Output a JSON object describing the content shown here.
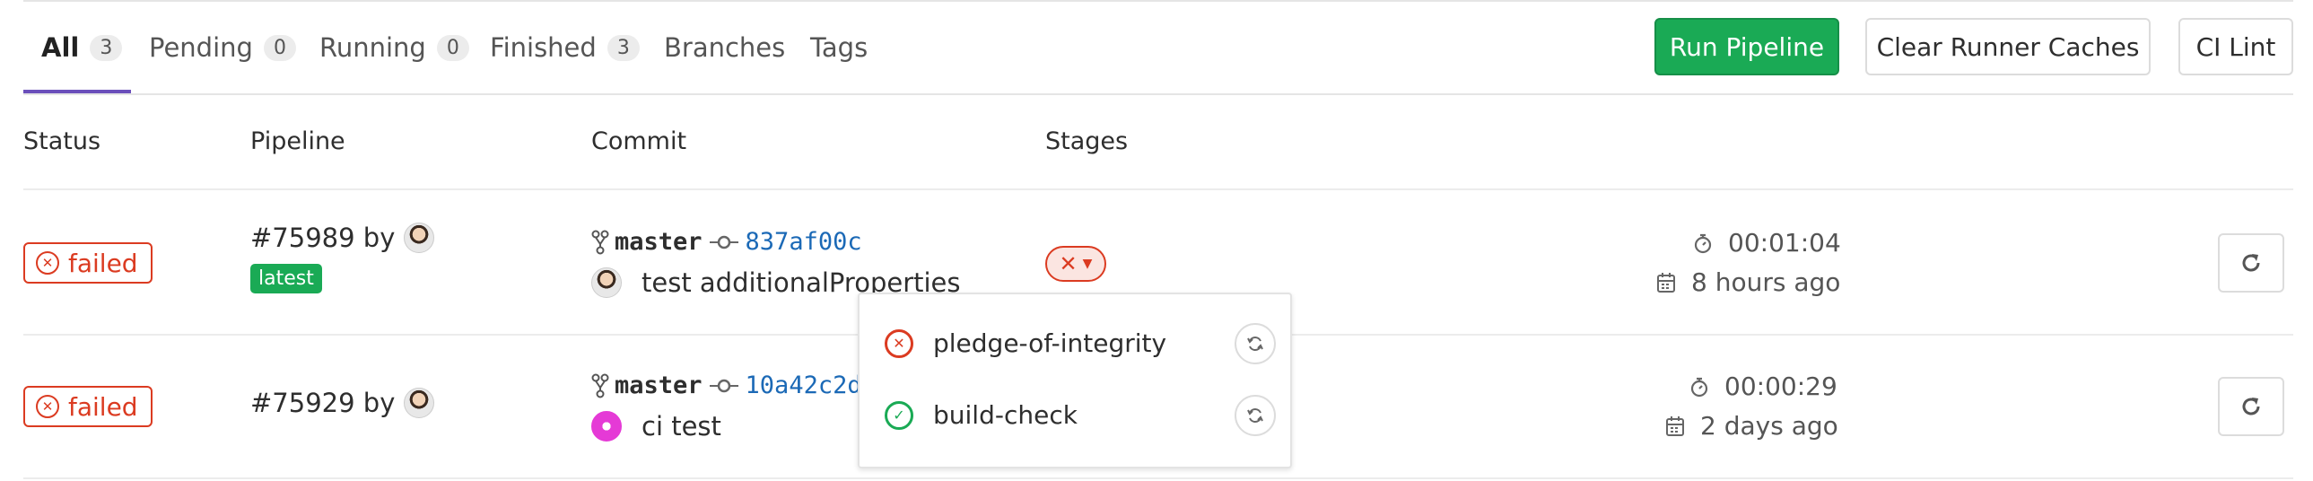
{
  "tabs": [
    {
      "label": "All",
      "count": "3"
    },
    {
      "label": "Pending",
      "count": "0"
    },
    {
      "label": "Running",
      "count": "0"
    },
    {
      "label": "Finished",
      "count": "3"
    },
    {
      "label": "Branches"
    },
    {
      "label": "Tags"
    }
  ],
  "actions": {
    "run_pipeline": "Run Pipeline",
    "clear_caches": "Clear Runner Caches",
    "ci_lint": "CI Lint"
  },
  "columns": {
    "status": "Status",
    "pipeline": "Pipeline",
    "commit": "Commit",
    "stages": "Stages"
  },
  "pipelines": [
    {
      "status": "failed",
      "id": "#75989",
      "by": "by",
      "tag": "latest",
      "branch": "master",
      "sha": "837af00c",
      "title": "test additionalProperties",
      "duration": "00:01:04",
      "finished": "8 hours ago"
    },
    {
      "status": "failed",
      "id": "#75929",
      "by": "by",
      "branch": "master",
      "sha": "10a42c2d",
      "title": "ci test",
      "duration": "00:00:29",
      "finished": "2 days ago"
    }
  ],
  "stage_dropdown": [
    {
      "name": "pledge-of-integrity",
      "status": "failed"
    },
    {
      "name": "build-check",
      "status": "passed"
    }
  ],
  "colors": {
    "accent": "#6b4fbb",
    "success": "#1aaa55",
    "danger": "#db3b21",
    "link": "#1b69b6"
  }
}
